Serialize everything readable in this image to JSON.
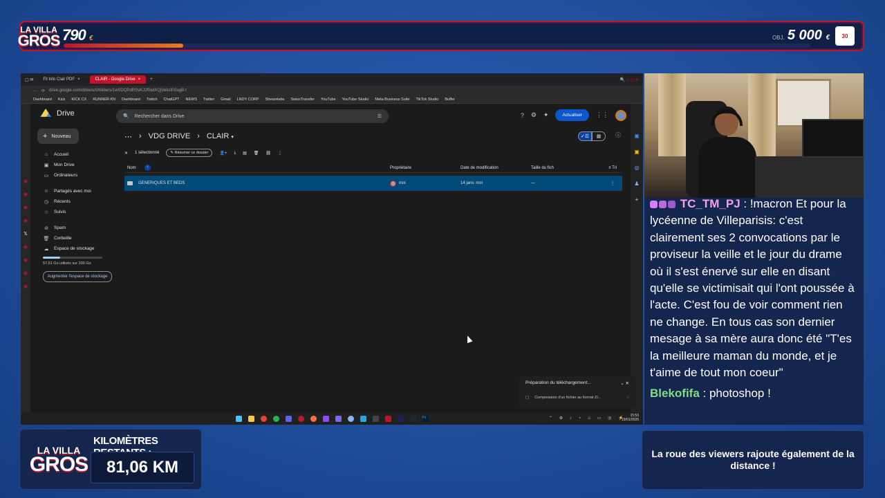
{
  "overlay": {
    "logo_line1": "LA VILLA",
    "logo_line2": "GROS",
    "counter_value": "790",
    "counter_unit": "€",
    "progress_fraction": 0.16,
    "goal_prefix": "OBJ.",
    "goal_value": "5 000",
    "goal_unit": "€",
    "badge_text": "30",
    "km_label": "KILOMÈTRES RESTANTS :",
    "km_value": "81,06 KM",
    "roue_text": "La roue des viewers rajoute également de la distance !"
  },
  "browser": {
    "tabs": [
      {
        "label": "Fil Info Clair PDF",
        "active": false
      },
      {
        "label": "CLAIR - Google Drive",
        "active": true
      }
    ],
    "address": "drive.google.com/drive/u/0/folders/1wSDQPdRSvKJ2f0wtXQjVeksf0SugB-t",
    "bookmarks": [
      "Dashboard",
      "Kick",
      "KICK CX",
      "RUNNER KN",
      "Dashboard",
      "Twitch",
      "ChatGPT",
      "NEWS",
      "Twitter",
      "Gmail",
      "LNDY CORP",
      "Streamlabs",
      "SwissTransfer",
      "YouTube",
      "YouTube Studio",
      "Meta Business Suite",
      "TikTok Studio",
      "Buffer"
    ]
  },
  "drive": {
    "app_name": "Drive",
    "search_placeholder": "Rechercher dans Drive",
    "update_button": "Actualiser",
    "new_button": "Nouveau",
    "nav": {
      "home": "Accueil",
      "my_drive": "Mon Drive",
      "computers": "Ordinateurs",
      "shared": "Partagés avec moi",
      "recent": "Récents",
      "starred": "Suivis",
      "spam": "Spam",
      "trash": "Corbeille",
      "storage": "Espace de stockage"
    },
    "storage_text": "57,61 Go utilisés sur 200 Go",
    "storage_fraction": 0.29,
    "upgrade_button": "Augmenter l'espace de stockage",
    "breadcrumb_root": "VDG DRIVE",
    "breadcrumb_current": "CLAIR",
    "selection_text": "1 sélectionné",
    "summarize_chip": "Résumer ce dossier",
    "columns": {
      "name": "Nom",
      "owner": "Propriétaire",
      "modified": "Date de modification",
      "size": "Taille du fich",
      "sort": "Tri"
    },
    "row": {
      "name": "GENERIQUES ET BEDS",
      "owner": "moi",
      "modified": "14 janv. moi",
      "size": "—"
    },
    "download_title": "Préparation du téléchargement...",
    "download_item": "Compression d'un fichier au format ZI..."
  },
  "taskbar": {
    "time": "15:53",
    "date": "19/01/2026"
  },
  "chat": {
    "msg1_user": "TC_TM_PJ",
    "msg1_text": "!macron Et pour la lycéenne de Villeparisis: c'est clairement ses 2 convocations par le proviseur la veille et le jour du drame où il s'est énervé sur elle en disant qu'elle se victimisait qui l'ont poussée à l'acte. C'est fou de voir comment rien ne change. En tous cas son dernier mesage à sa mère aura donc été \"T'es la meilleure maman du monde, et je t'aime de tout mon coeur\"",
    "msg2_user": "Blekofifa",
    "msg2_text": "photoshop !"
  },
  "colors": {
    "accent_red": "#c0142b",
    "drive_blue": "#0b57d0",
    "selected_row": "#004a77",
    "panel_bg": "#14254e"
  }
}
